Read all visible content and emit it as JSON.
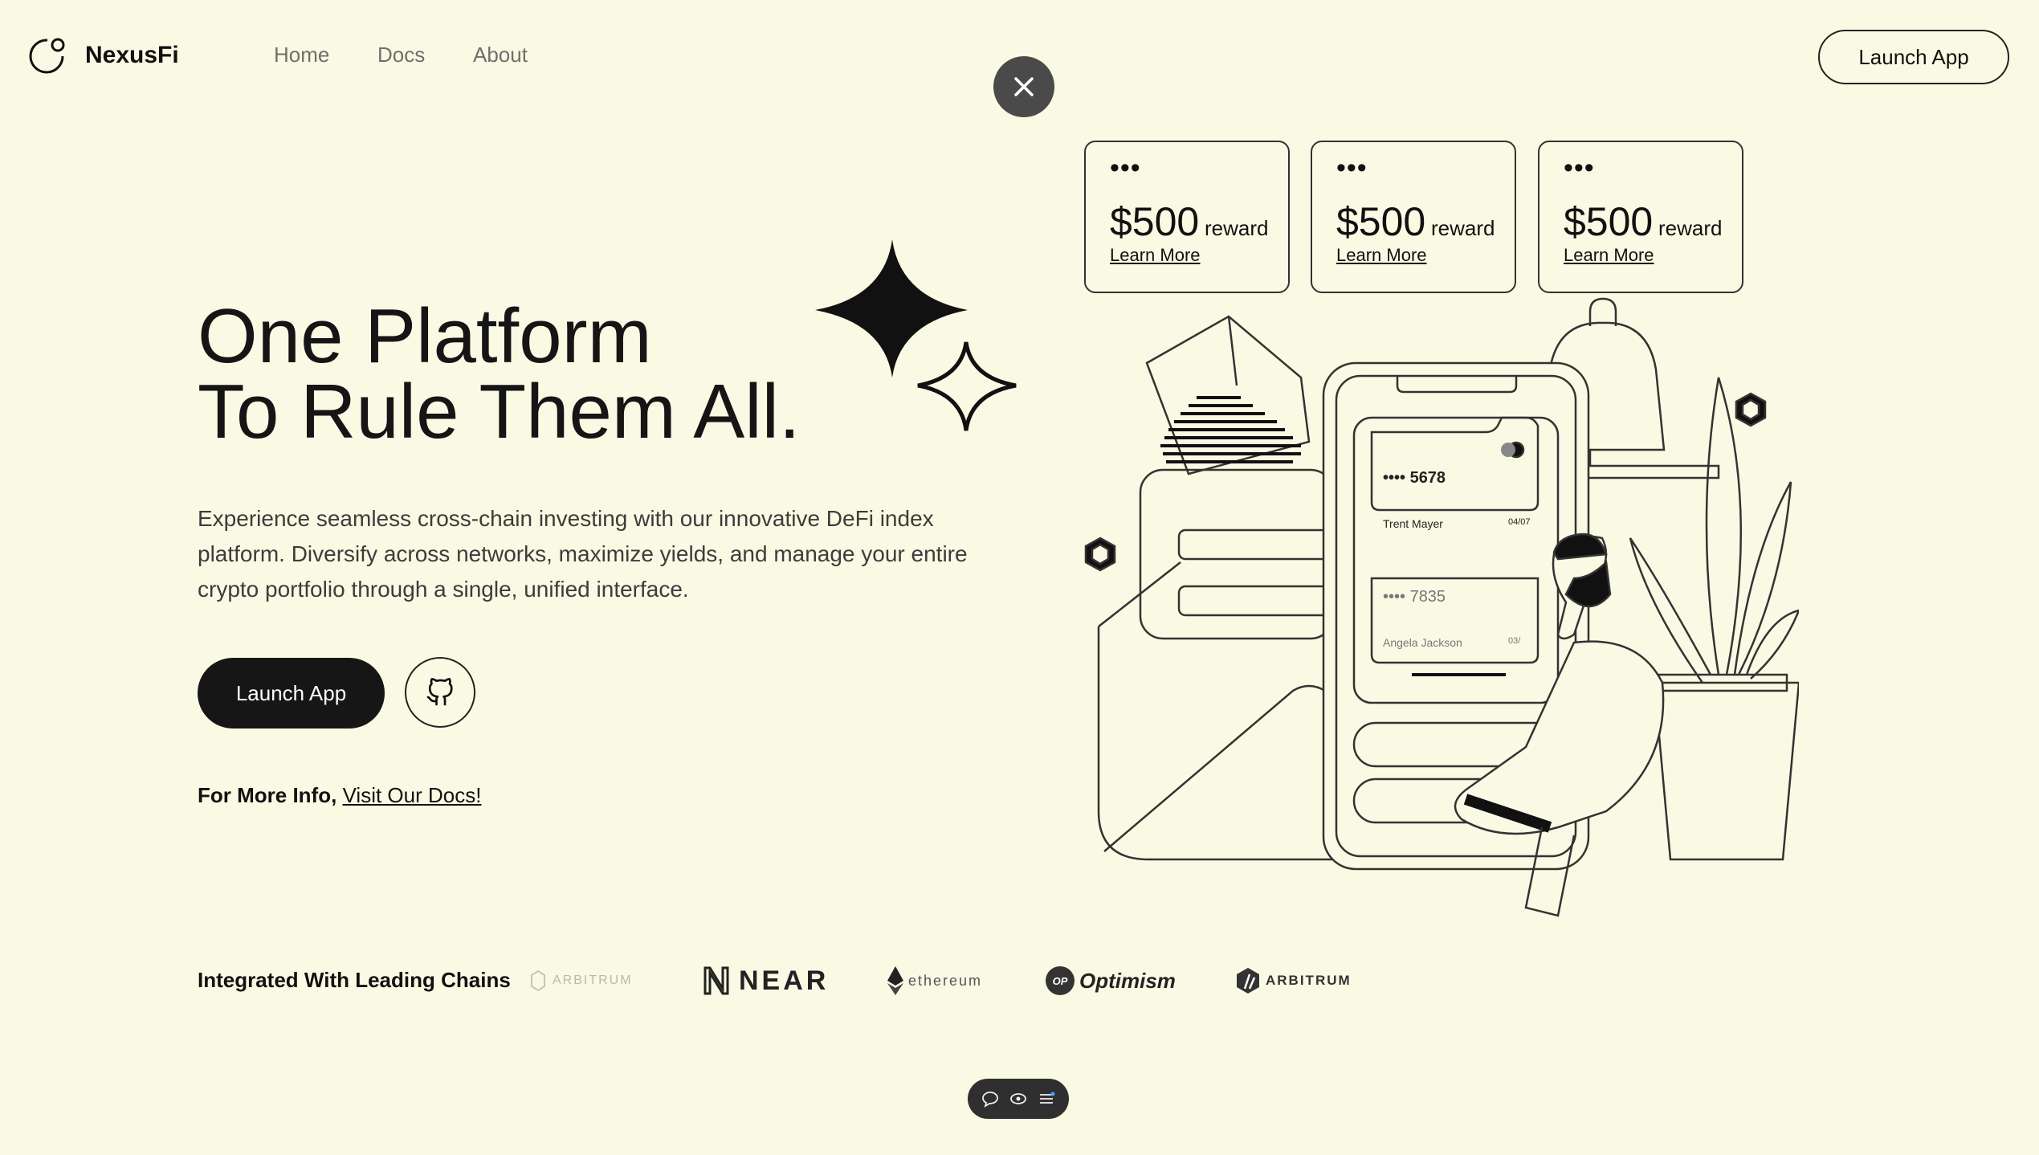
{
  "brand": {
    "name": "NexusFi"
  },
  "nav": {
    "home": "Home",
    "docs": "Docs",
    "about": "About"
  },
  "header": {
    "launch_label": "Launch App"
  },
  "hero": {
    "title_line1": "One Platform",
    "title_line2": "To Rule Them All.",
    "description": "Experience seamless cross-chain investing with our innovative DeFi index platform. Diversify across networks, maximize yields, and manage your entire crypto portfolio through a single, unified interface.",
    "launch_label": "Launch App",
    "more_prefix": "For More Info,",
    "more_link": "Visit Our Docs!"
  },
  "reward_cards": [
    {
      "amount": "$500",
      "label": "reward",
      "link": "Learn More"
    },
    {
      "amount": "$500",
      "label": "reward",
      "link": "Learn More"
    },
    {
      "amount": "$500",
      "label": "reward",
      "link": "Learn More"
    }
  ],
  "illustration": {
    "card1_number": "•••• 5678",
    "card1_name": "Trent Mayer",
    "card1_exp": "04/07",
    "card2_number": "•••• 7835",
    "card2_name": "Angela Jackson",
    "card2_exp": "03/"
  },
  "chains": {
    "title": "Integrated With Leading Chains",
    "items": [
      {
        "name": "ARBITRUM",
        "style": "faded"
      },
      {
        "name": "NEAR",
        "style": "bold"
      },
      {
        "name": "ethereum",
        "style": "light"
      },
      {
        "name": "Optimism",
        "badge": "OP",
        "style": "italic"
      },
      {
        "name": "ARBITRUM",
        "style": "normal"
      }
    ]
  },
  "icons": {
    "close": "close-icon",
    "github": "github-icon",
    "toolbar": [
      "comment-icon",
      "eye-icon",
      "menu-icon"
    ]
  },
  "colors": {
    "background": "#faf9e3",
    "dark": "#161616",
    "close_bg": "#4a4a4a",
    "nav_text": "#6f6f6f"
  }
}
